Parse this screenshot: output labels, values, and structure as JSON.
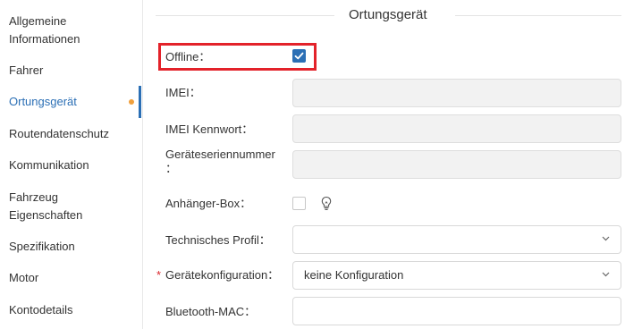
{
  "sidebar": {
    "items": [
      {
        "label_line1": "Allgemeine",
        "label_line2": "Informationen"
      },
      {
        "label_line1": "Fahrer"
      },
      {
        "label_line1": "Ortungsgerät",
        "active": true,
        "has_dot": true
      },
      {
        "label_line1": "Routendatenschutz"
      },
      {
        "label_line1": "Kommunikation"
      },
      {
        "label_line1": "Fahrzeug",
        "label_line2": "Eigenschaften"
      },
      {
        "label_line1": "Spezifikation"
      },
      {
        "label_line1": "Motor"
      },
      {
        "label_line1": "Kontodetails"
      }
    ]
  },
  "section": {
    "title": "Ortungsgerät"
  },
  "form": {
    "offline": {
      "label": "Offline：",
      "checked": true
    },
    "imei": {
      "label": "IMEI：",
      "value": ""
    },
    "imei_password": {
      "label": "IMEI Kennwort：",
      "value": ""
    },
    "serial": {
      "label_line1": "Geräteseriennummer",
      "label_line2": "：",
      "value": ""
    },
    "trailer_box": {
      "label": "Anhänger-Box：",
      "checked": false,
      "icon": "lightbulb-icon"
    },
    "technical_profile": {
      "label": "Technisches Profil：",
      "selected": ""
    },
    "device_config": {
      "required_mark": "*",
      "label": "Gerätekonfiguration：",
      "selected": "keine Konfiguration"
    },
    "bluetooth_mac": {
      "label": "Bluetooth-MAC：",
      "value": ""
    }
  },
  "colors": {
    "accent": "#2b6fb5",
    "active_dot": "#f0a03c",
    "highlight_border": "#e3222a",
    "required": "#d9262c"
  }
}
